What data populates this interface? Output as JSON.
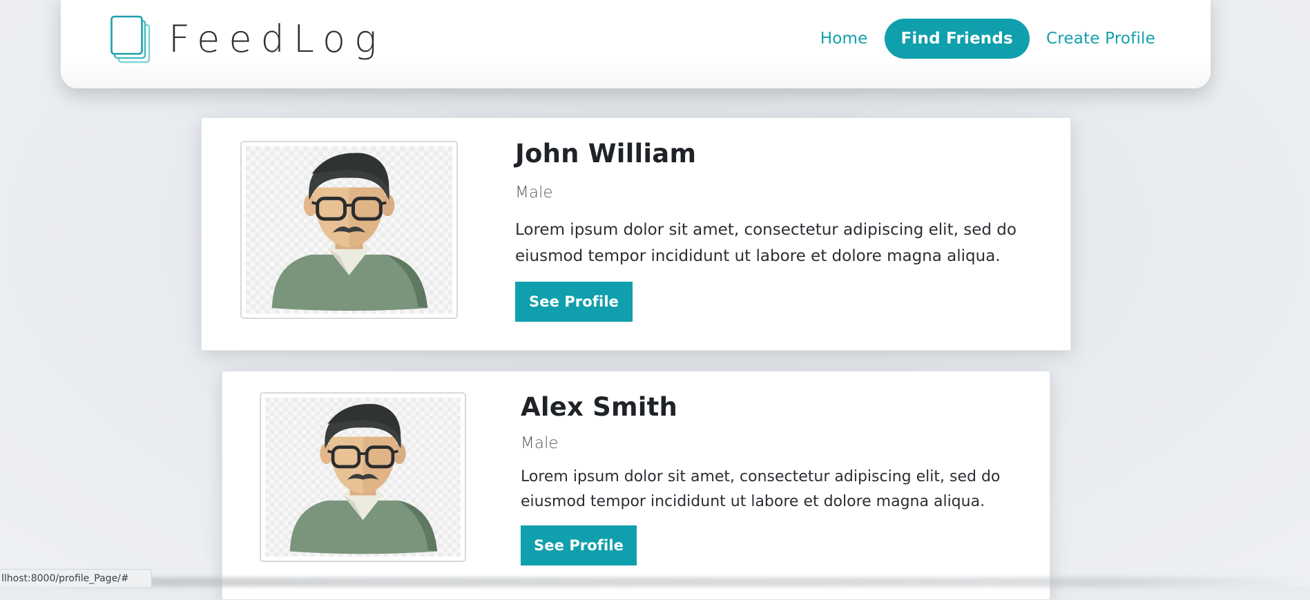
{
  "brand": {
    "name": "FeedLog",
    "accent_color": "#109fac",
    "logo_icon": "stacked-pages-icon"
  },
  "nav": {
    "items": [
      {
        "label": "Home",
        "active": false
      },
      {
        "label": "Find Friends",
        "active": true
      },
      {
        "label": "Create Profile",
        "active": false
      }
    ]
  },
  "profiles": [
    {
      "name": "John William",
      "gender": "Male",
      "bio": "Lorem ipsum dolor sit amet, consectetur adipiscing elit, sed do eiusmod tempor incididunt ut labore et dolore magna aliqua.",
      "button_label": "See Profile",
      "avatar_icon": "man-with-glasses-avatar-icon"
    },
    {
      "name": "Alex Smith",
      "gender": "Male",
      "bio": "Lorem ipsum dolor sit amet, consectetur adipiscing elit, sed do eiusmod tempor incididunt ut labore et dolore magna aliqua.",
      "button_label": "See Profile",
      "avatar_icon": "man-with-glasses-avatar-icon"
    }
  ],
  "status_bar": {
    "text": "llhost:8000/profile_Page/#"
  }
}
